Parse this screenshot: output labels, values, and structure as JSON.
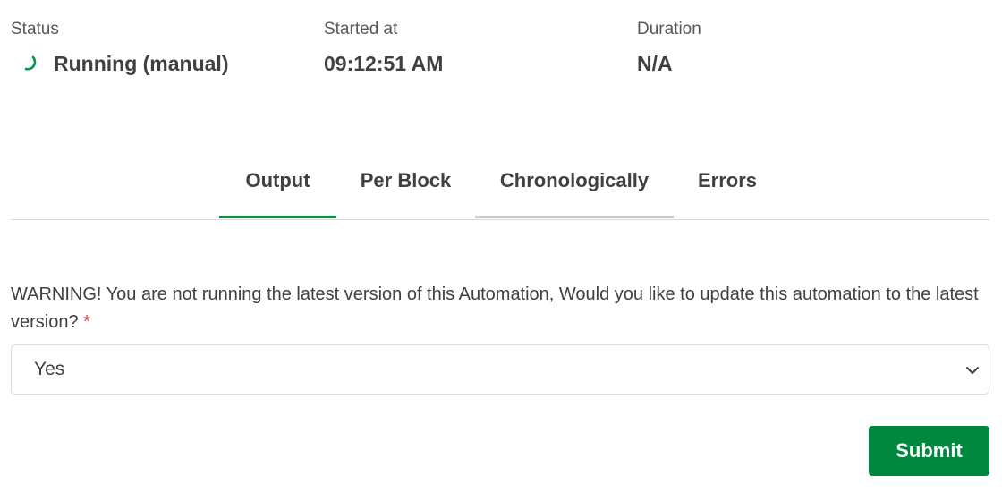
{
  "summary": {
    "status": {
      "label": "Status",
      "value": "Running (manual)",
      "icon": "spinner-icon"
    },
    "started": {
      "label": "Started at",
      "value": "09:12:51 AM"
    },
    "duration": {
      "label": "Duration",
      "value": "N/A"
    }
  },
  "tabs": [
    {
      "label": "Output",
      "state": "active"
    },
    {
      "label": "Per Block",
      "state": "default"
    },
    {
      "label": "Chronologically",
      "state": "hover"
    },
    {
      "label": "Errors",
      "state": "default"
    }
  ],
  "form": {
    "question": "WARNING! You are not running the latest version of this Automation, Would you like to update this automation to the latest version?",
    "required_marker": "*",
    "select_value": "Yes",
    "submit_label": "Submit"
  },
  "colors": {
    "accent_green": "#009845",
    "submit_green": "#00873e",
    "required_red": "#d4393b",
    "text": "#404040"
  }
}
